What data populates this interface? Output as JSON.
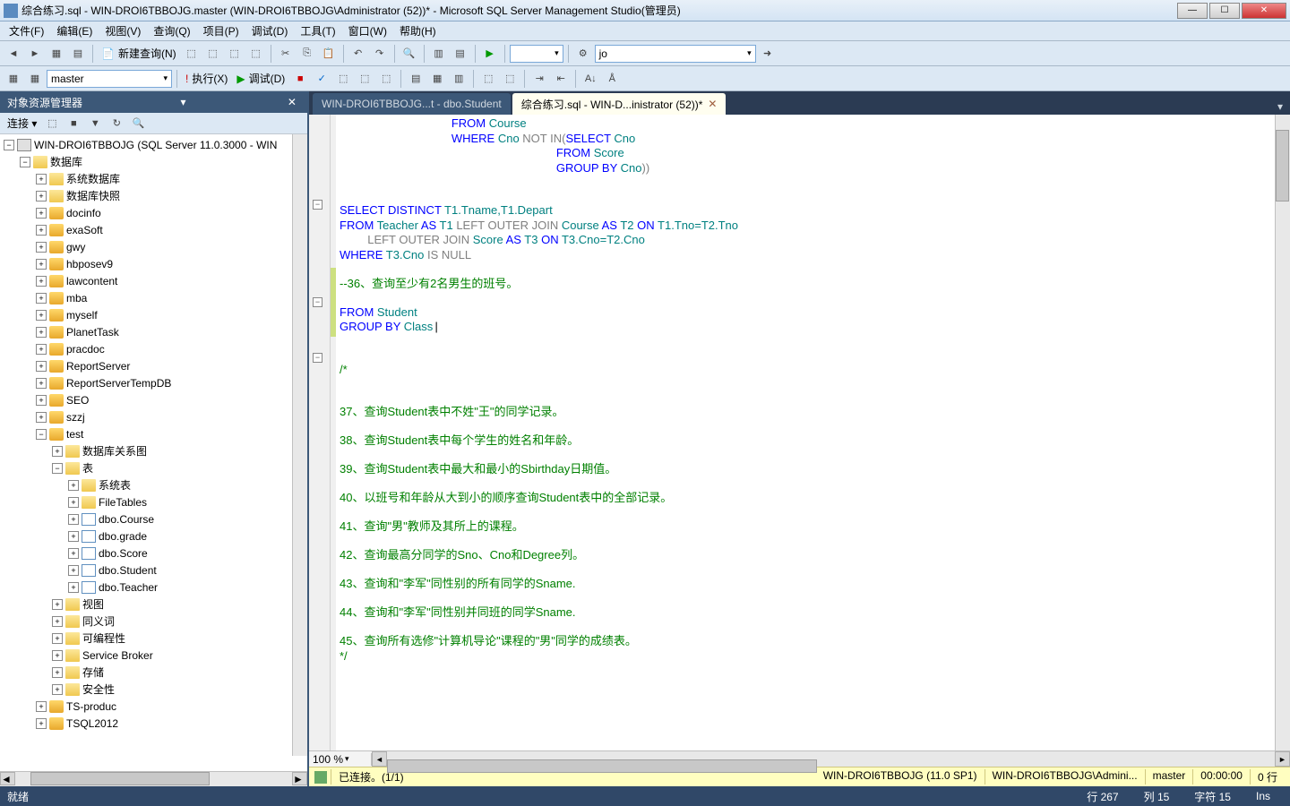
{
  "window": {
    "title": "综合练习.sql - WIN-DROI6TBBOJG.master (WIN-DROI6TBBOJG\\Administrator (52))* - Microsoft SQL Server Management Studio(管理员)"
  },
  "menu": {
    "file": "文件(F)",
    "edit": "编辑(E)",
    "view": "视图(V)",
    "query": "查询(Q)",
    "project": "项目(P)",
    "debug": "调试(D)",
    "tool": "工具(T)",
    "window": "窗口(W)",
    "help": "帮助(H)"
  },
  "toolbar1": {
    "newquery": "新建查询(N)",
    "search_value": "jo"
  },
  "toolbar2": {
    "db_combo": "master",
    "execute": "执行(X)",
    "debug": "调试(D)"
  },
  "objexp": {
    "title": "对象资源管理器",
    "connect": "连接 ▾",
    "server": "WIN-DROI6TBBOJG (SQL Server 11.0.3000 - WIN",
    "db_folder": "数据库",
    "sys_db": "系统数据库",
    "snapshot": "数据库快照",
    "dbs": [
      "docinfo",
      "exaSoft",
      "gwy",
      "hbposev9",
      "lawcontent",
      "mba",
      "myself",
      "PlanetTask",
      "pracdoc",
      "ReportServer",
      "ReportServerTempDB",
      "SEO",
      "szzj",
      "test"
    ],
    "folders_under_test": {
      "diagram": "数据库关系图",
      "tables": "表",
      "systables": "系统表",
      "filetables": "FileTables",
      "tlist": [
        "dbo.Course",
        "dbo.grade",
        "dbo.Score",
        "dbo.Student",
        "dbo.Teacher"
      ],
      "views": "视图",
      "synonyms": "同义词",
      "programmability": "可编程性",
      "servicebroker": "Service Broker",
      "storage": "存储",
      "security": "安全性"
    },
    "extra": [
      "TS-produc",
      "TSQL2012"
    ]
  },
  "tabs": {
    "t1": "WIN-DROI6TBBOJG...t - dbo.Student",
    "t2": "综合练习.sql - WIN-D...inistrator (52))*"
  },
  "code": {
    "lines": [
      {
        "indent": "                ",
        "parts": [
          {
            "t": "FROM ",
            "c": "kw"
          },
          {
            "t": "Course",
            "c": "id"
          }
        ]
      },
      {
        "indent": "                ",
        "parts": [
          {
            "t": "WHERE ",
            "c": "kw"
          },
          {
            "t": "Cno ",
            "c": "id"
          },
          {
            "t": "NOT IN",
            "c": "op"
          },
          {
            "t": "(",
            "c": "op"
          },
          {
            "t": "SELECT ",
            "c": "kw"
          },
          {
            "t": "Cno",
            "c": "id"
          }
        ]
      },
      {
        "indent": "                               ",
        "parts": [
          {
            "t": "FROM ",
            "c": "kw"
          },
          {
            "t": "Score",
            "c": "id"
          }
        ]
      },
      {
        "indent": "                               ",
        "parts": [
          {
            "t": "GROUP BY ",
            "c": "kw"
          },
          {
            "t": "Cno",
            "c": "id"
          },
          {
            "t": "))",
            "c": "op"
          }
        ]
      },
      {
        "indent": "",
        "parts": []
      },
      {
        "indent": "",
        "parts": []
      },
      {
        "indent": "",
        "parts": [
          {
            "t": "SELECT DISTINCT ",
            "c": "kw"
          },
          {
            "t": "T1.Tname,T1.Depart",
            "c": "id"
          }
        ]
      },
      {
        "indent": "",
        "parts": [
          {
            "t": "FROM ",
            "c": "kw"
          },
          {
            "t": "Teacher ",
            "c": "id"
          },
          {
            "t": "AS ",
            "c": "kw"
          },
          {
            "t": "T1 ",
            "c": "id"
          },
          {
            "t": "LEFT OUTER JOIN ",
            "c": "op"
          },
          {
            "t": "Course ",
            "c": "id"
          },
          {
            "t": "AS ",
            "c": "kw"
          },
          {
            "t": "T2 ",
            "c": "id"
          },
          {
            "t": "ON ",
            "c": "kw"
          },
          {
            "t": "T1.Tno=T2.Tno",
            "c": "id"
          }
        ]
      },
      {
        "indent": "    ",
        "parts": [
          {
            "t": "LEFT OUTER JOIN ",
            "c": "op"
          },
          {
            "t": "Score ",
            "c": "id"
          },
          {
            "t": "AS ",
            "c": "kw"
          },
          {
            "t": "T3 ",
            "c": "id"
          },
          {
            "t": "ON ",
            "c": "kw"
          },
          {
            "t": "T3.Cno=T2.Cno",
            "c": "id"
          }
        ]
      },
      {
        "indent": "",
        "parts": [
          {
            "t": "WHERE ",
            "c": "kw"
          },
          {
            "t": "T3.Cno ",
            "c": "id"
          },
          {
            "t": "IS NULL",
            "c": "op"
          }
        ]
      },
      {
        "indent": "",
        "parts": []
      },
      {
        "indent": "",
        "parts": [
          {
            "t": "--36、查询至少有2名男生的班号。",
            "c": "cm"
          }
        ]
      },
      {
        "indent": "",
        "parts": []
      },
      {
        "indent": "",
        "parts": [
          {
            "t": "FROM ",
            "c": "kw"
          },
          {
            "t": "Student",
            "c": "id"
          }
        ]
      },
      {
        "indent": "",
        "parts": [
          {
            "t": "GROUP BY ",
            "c": "kw"
          },
          {
            "t": "Class",
            "c": "id"
          },
          {
            "t": "|",
            "c": ""
          }
        ]
      },
      {
        "indent": "",
        "parts": []
      },
      {
        "indent": "",
        "parts": []
      },
      {
        "indent": "",
        "parts": [
          {
            "t": "/*",
            "c": "cm"
          }
        ]
      },
      {
        "indent": "",
        "parts": []
      },
      {
        "indent": "",
        "parts": []
      },
      {
        "indent": "",
        "parts": [
          {
            "t": "37、查询Student表中不姓\"王\"的同学记录。",
            "c": "cm"
          }
        ]
      },
      {
        "indent": "",
        "parts": []
      },
      {
        "indent": "",
        "parts": [
          {
            "t": "38、查询Student表中每个学生的姓名和年龄。",
            "c": "cm"
          }
        ]
      },
      {
        "indent": "",
        "parts": []
      },
      {
        "indent": "",
        "parts": [
          {
            "t": "39、查询Student表中最大和最小的Sbirthday日期值。",
            "c": "cm"
          }
        ]
      },
      {
        "indent": "",
        "parts": []
      },
      {
        "indent": "",
        "parts": [
          {
            "t": "40、以班号和年龄从大到小的顺序查询Student表中的全部记录。",
            "c": "cm"
          }
        ]
      },
      {
        "indent": "",
        "parts": []
      },
      {
        "indent": "",
        "parts": [
          {
            "t": "41、查询\"男\"教师及其所上的课程。",
            "c": "cm"
          }
        ]
      },
      {
        "indent": "",
        "parts": []
      },
      {
        "indent": "",
        "parts": [
          {
            "t": "42、查询最高分同学的Sno、Cno和Degree列。",
            "c": "cm"
          }
        ]
      },
      {
        "indent": "",
        "parts": []
      },
      {
        "indent": "",
        "parts": [
          {
            "t": "43、查询和\"李军\"同性别的所有同学的Sname.",
            "c": "cm"
          }
        ]
      },
      {
        "indent": "",
        "parts": []
      },
      {
        "indent": "",
        "parts": [
          {
            "t": "44、查询和\"李军\"同性别并同班的同学Sname.",
            "c": "cm"
          }
        ]
      },
      {
        "indent": "",
        "parts": []
      },
      {
        "indent": "",
        "parts": [
          {
            "t": "45、查询所有选修\"计算机导论\"课程的\"男\"同学的成绩表。",
            "c": "cm"
          }
        ]
      },
      {
        "indent": "",
        "parts": [
          {
            "t": "*/",
            "c": "cm"
          }
        ]
      }
    ]
  },
  "zoom": "100 %",
  "editor_status": {
    "conn": "已连接。(1/1)",
    "server": "WIN-DROI6TBBOJG (11.0 SP1)",
    "user": "WIN-DROI6TBBOJG\\Admini...",
    "db": "master",
    "time": "00:00:00",
    "rows": "0 行"
  },
  "app_status": {
    "ready": "就绪",
    "line": "行 267",
    "col": "列 15",
    "char": "字符 15",
    "ins": "Ins"
  }
}
